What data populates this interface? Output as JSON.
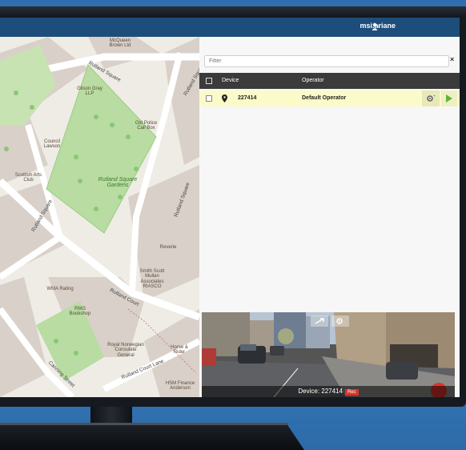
{
  "header": {
    "username": "msi.ariane",
    "user_icon": "user-icon"
  },
  "map": {
    "streets": [
      "Rutland Square",
      "Rutland Square",
      "Rutland Square",
      "Rutland Court",
      "Rutland Court Lane",
      "Canning Street"
    ],
    "park": "Rutland Square Gardens",
    "places": {
      "mcqueen": "McQueen Brown Ltd",
      "gilson": "Gilson Gray LLP",
      "council": "Council Lawson",
      "scottish": "Scottish Arts Club",
      "oldpolice": "Old Police Call Box",
      "reverie": "Reverie",
      "smith": "Smith Scott Mullan Associates RIASCO",
      "wma": "WMA Rating",
      "rmg": "RMG Bookshop",
      "royal": "Royal Norwegian Consulate General",
      "horse": "Horse & Rider",
      "hsm": "HSM Finance Anderson"
    }
  },
  "panel": {
    "filter_placeholder": "Filter",
    "close": "×",
    "columns": {
      "device": "Device",
      "operator": "Operator"
    },
    "rows": [
      {
        "device": "227414",
        "operator": "Default Operator"
      }
    ]
  },
  "video": {
    "device_label": "Device: 227414",
    "rec": "Rec"
  }
}
